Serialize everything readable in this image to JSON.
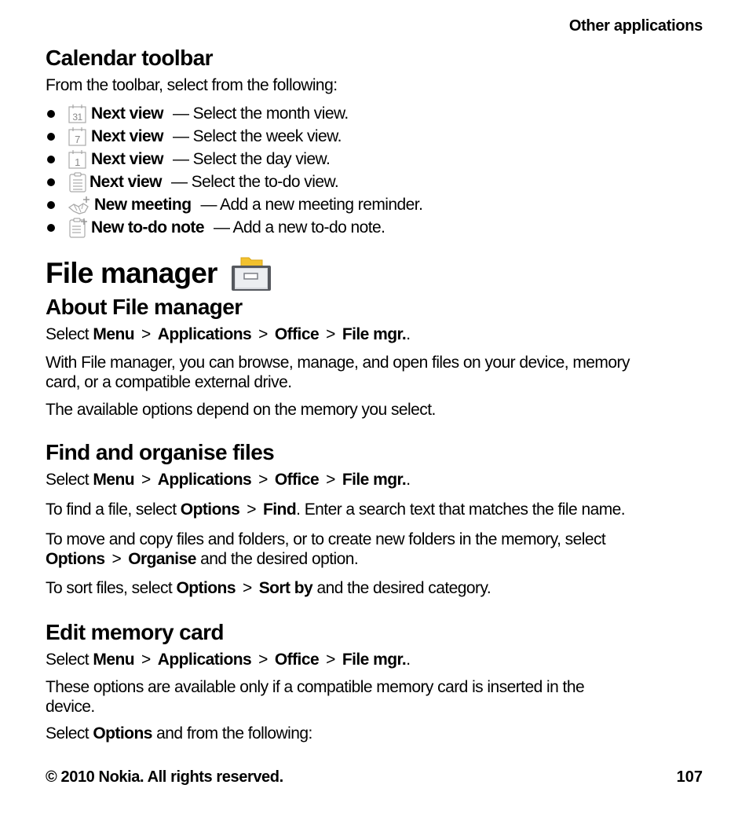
{
  "running_head": "Other applications",
  "calendar_toolbar": {
    "heading": "Calendar toolbar",
    "intro": "From the toolbar, select from the following:",
    "items": [
      {
        "icon": "calendar-month-icon",
        "icon_text": "31",
        "label": "Next view",
        "desc": "— Select the month view."
      },
      {
        "icon": "calendar-week-icon",
        "icon_text": "7",
        "label": "Next view",
        "desc": "— Select the week view."
      },
      {
        "icon": "calendar-day-icon",
        "icon_text": "1",
        "label": "Next view",
        "desc": "— Select the day view."
      },
      {
        "icon": "todo-list-icon",
        "icon_text": "",
        "label": "Next view",
        "desc": "— Select the to-do view."
      },
      {
        "icon": "new-meeting-icon",
        "icon_text": "",
        "label": "New meeting",
        "desc": "— Add a new meeting reminder."
      },
      {
        "icon": "new-todo-icon",
        "icon_text": "",
        "label": "New to-do note",
        "desc": "— Add a new to-do note."
      }
    ]
  },
  "file_manager": {
    "title": "File manager",
    "icon": "file-manager-drawer-icon"
  },
  "about": {
    "heading": "About File manager",
    "path": {
      "prefix": "Select",
      "steps": [
        "Menu",
        "Applications",
        "Office",
        "File mgr."
      ],
      "suffix": ".",
      "separator": ">"
    },
    "para1_line1": "With File manager, you can browse, manage, and open files on your device, memory",
    "para1_line2": "card, or a compatible external drive.",
    "para2": "The available options depend on the memory you select."
  },
  "find": {
    "heading": "Find and organise files",
    "path": {
      "prefix": "Select",
      "steps": [
        "Menu",
        "Applications",
        "Office",
        "File mgr."
      ],
      "suffix": ".",
      "separator": ">"
    },
    "find_pre": "To find a file, select",
    "find_opt": "Options",
    "find_cmd": "Find",
    "find_post": ". Enter a search text that matches the file name.",
    "move_line1": "To move and copy files and folders, or to create new folders in the memory, select",
    "move_opt": "Options",
    "move_cmd": "Organise",
    "move_post": "and the desired option.",
    "sort_pre": "To sort files, select",
    "sort_opt": "Options",
    "sort_cmd": "Sort by",
    "sort_post": "and the desired category."
  },
  "edit": {
    "heading": "Edit memory card",
    "path": {
      "prefix": "Select",
      "steps": [
        "Menu",
        "Applications",
        "Office",
        "File mgr."
      ],
      "suffix": ".",
      "separator": ">"
    },
    "para1_line1": "These options are available only if a compatible memory card is inserted in the",
    "para1_line2": "device.",
    "select_pre": "Select",
    "select_opt": "Options",
    "select_post": "and from the following:"
  },
  "footer": {
    "copyright": "© 2010 Nokia. All rights reserved.",
    "page_number": "107"
  }
}
